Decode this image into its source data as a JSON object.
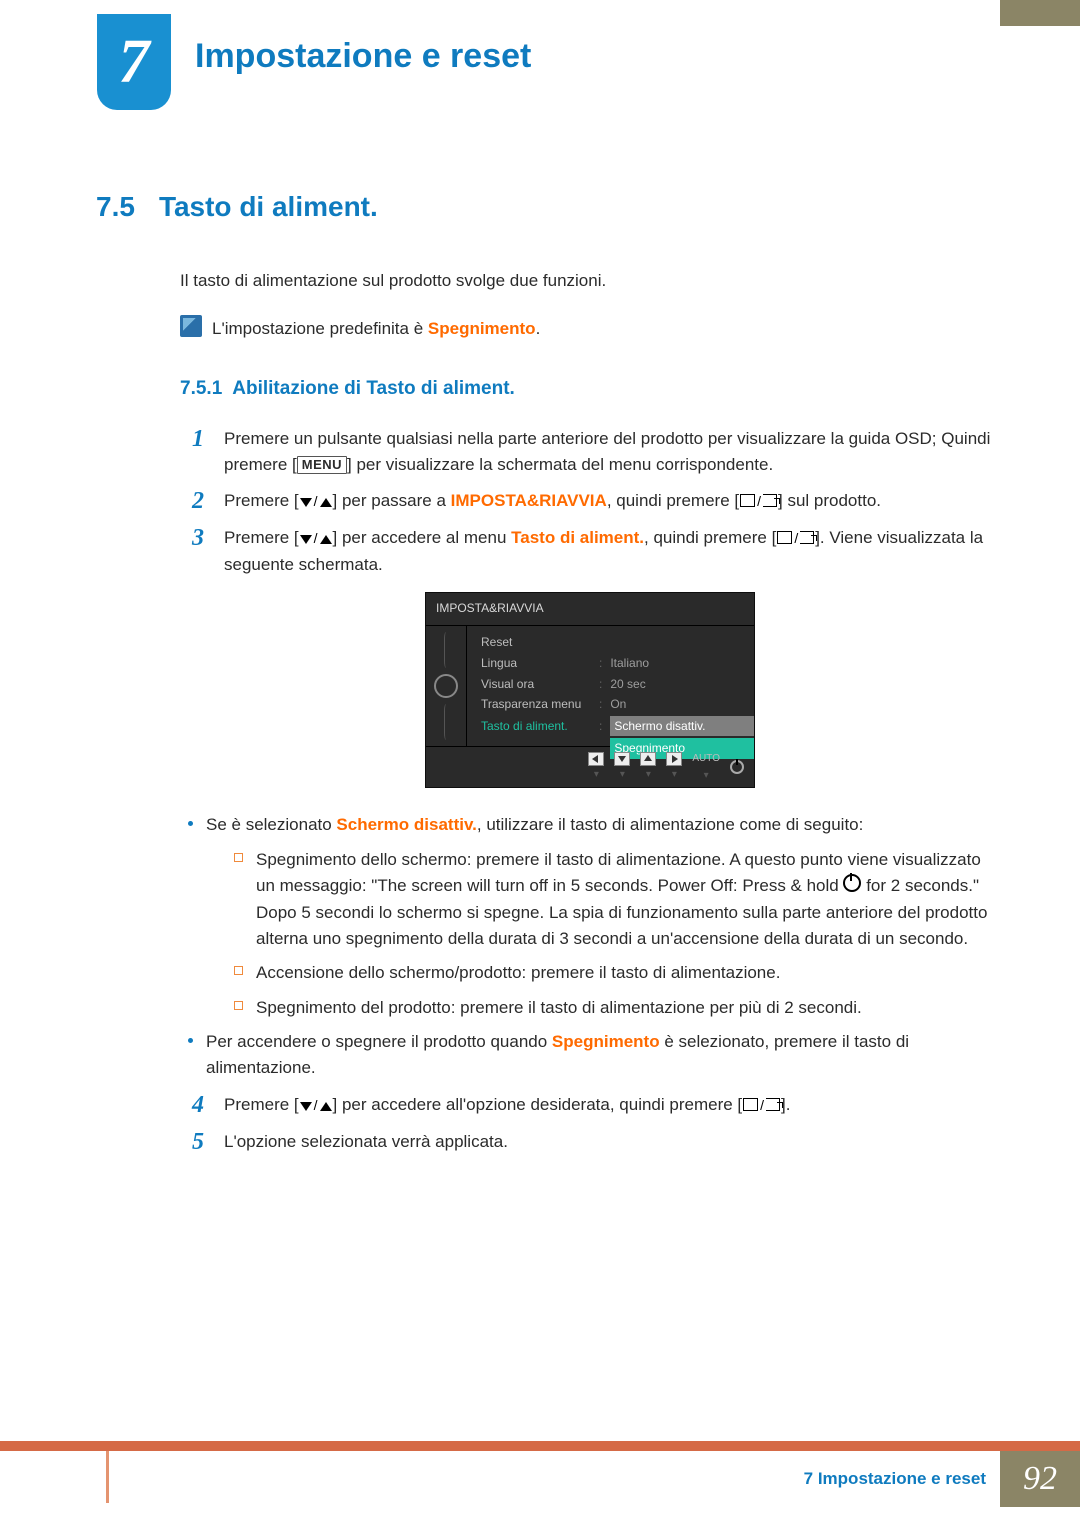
{
  "chapter": {
    "number": "7",
    "title": "Impostazione e reset"
  },
  "section": {
    "number": "7.5",
    "title": "Tasto di aliment."
  },
  "intro": "Il tasto di alimentazione sul prodotto svolge due funzioni.",
  "note": {
    "pre": "L'impostazione predefinita è ",
    "strong": "Spegnimento",
    "post": "."
  },
  "subsection": {
    "number": "7.5.1",
    "title": "Abilitazione di Tasto di aliment."
  },
  "steps": {
    "s1a": "Premere un pulsante qualsiasi nella parte anteriore del prodotto per visualizzare la guida OSD; Quindi premere [",
    "s1_key": "MENU",
    "s1b": "] per visualizzare la schermata del menu corrispondente.",
    "s2a": "Premere [",
    "s2b": "] per passare a ",
    "s2_strong": "IMPOSTA&RIAVVIA",
    "s2c": ", quindi premere [",
    "s2d": "] sul prodotto.",
    "s3a": "Premere [",
    "s3b": "] per accedere al menu ",
    "s3_strong": "Tasto di aliment.",
    "s3c": ", quindi premere [",
    "s3d": "]. Viene visualizzata la seguente schermata.",
    "s4a": "Premere [",
    "s4b": "] per accedere all'opzione desiderata, quindi premere [",
    "s4c": "].",
    "s5": "L'opzione selezionata verrà applicata."
  },
  "osd": {
    "title": "IMPOSTA&RIAVVIA",
    "rows": [
      {
        "label": "Reset",
        "value": ""
      },
      {
        "label": "Lingua",
        "value": "Italiano"
      },
      {
        "label": "Visual ora",
        "value": "20 sec"
      },
      {
        "label": "Trasparenza menu",
        "value": "On"
      }
    ],
    "active_label": "Tasto di aliment.",
    "options": [
      "Schermo disattiv.",
      "Spegnimento"
    ],
    "foot_auto": "AUTO"
  },
  "bullets": {
    "b1a": "Se è selezionato ",
    "b1_strong": "Schermo disattiv.",
    "b1b": ", utilizzare il tasto di alimentazione come di seguito:",
    "sub1a": "Spegnimento dello schermo: premere il tasto di alimentazione. A questo punto viene visualizzato un messaggio: \"The screen will turn off in 5 seconds. Power Off: Press & hold ",
    "sub1b": " for 2 seconds.\" Dopo 5 secondi lo schermo si spegne. La spia di funzionamento sulla parte anteriore del prodotto alterna uno spegnimento della durata di 3 secondi a un'accensione della durata di un secondo.",
    "sub2": "Accensione dello schermo/prodotto: premere il tasto di alimentazione.",
    "sub3": "Spegnimento del prodotto: premere il tasto di alimentazione per più di 2 secondi.",
    "b2a": "Per accendere o spegnere il prodotto quando ",
    "b2_strong": "Spegnimento",
    "b2b": " è selezionato, premere il tasto di alimentazione."
  },
  "footer": {
    "label": "7 Impostazione e reset",
    "page": "92"
  }
}
